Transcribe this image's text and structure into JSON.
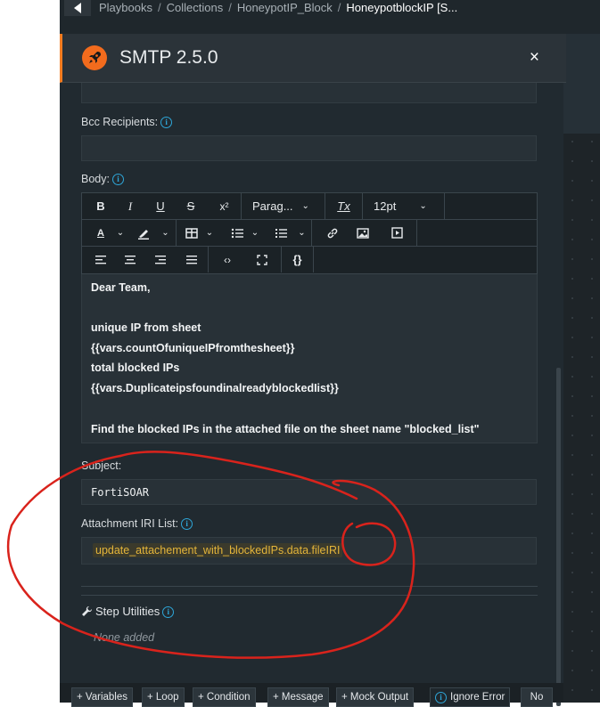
{
  "breadcrumb": {
    "items": [
      "Playbooks",
      "Collections",
      "HoneypotIP_Block"
    ],
    "current": "HoneypotblockIP [S..."
  },
  "panel": {
    "title": "SMTP 2.5.0",
    "close_label": "×"
  },
  "fields": {
    "bcc_label": "Bcc Recipients:",
    "bcc_value": "",
    "body_label": "Body:",
    "subject_label": "Subject:",
    "subject_value": "FortiSOAR",
    "attachment_label": "Attachment IRI List:",
    "attachment_value": "update_attachement_with_blockedIPs.data.fileIRI"
  },
  "editor_toolbar": {
    "bold": "B",
    "italic": "I",
    "underline": "U",
    "strike": "S",
    "superscript": "x²",
    "paragraph": "Parag...",
    "clear_format": "Tx",
    "font_size": "12pt",
    "text_color": "A",
    "code": "‹›",
    "braces": "{}"
  },
  "body_lines": [
    "Dear Team,",
    "",
    "unique IP from sheet",
    "{{vars.countOfuniqueIPfromthesheet}}",
    "total blocked IPs",
    "{{vars.DuplicateipsfoundinalreadyblockedIist}}",
    "",
    "Find the blocked IPs in the attached file on the sheet name \"blocked_list\""
  ],
  "step_utilities": {
    "title": "Step Utilities",
    "empty": "None added"
  },
  "bottom_bar": {
    "variables": "+ Variables",
    "loop": "+ Loop",
    "condition": "+ Condition",
    "message": "+ Message",
    "mock_output": "+ Mock Output",
    "ignore_error": "Ignore Error",
    "no": "No"
  },
  "colors": {
    "accent": "#f47c20",
    "info": "#2ea6d8",
    "annotation": "#d9231c",
    "jinja_tag": "#e4b53a"
  }
}
